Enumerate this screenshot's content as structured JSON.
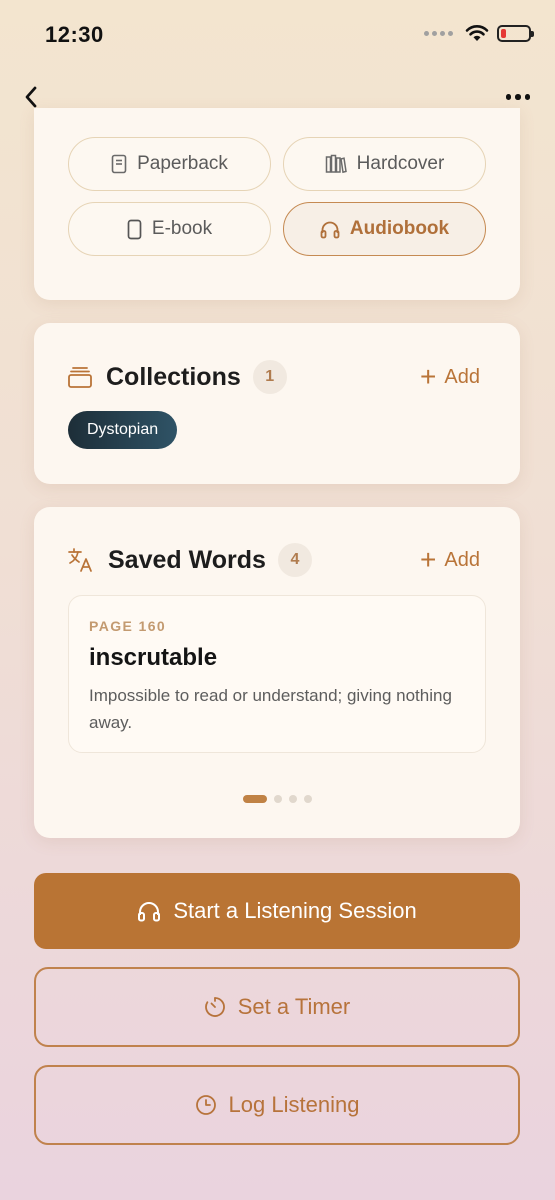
{
  "status_bar": {
    "time": "12:30"
  },
  "formats": {
    "items": [
      {
        "label": "Paperback",
        "icon": "book-icon",
        "active": false
      },
      {
        "label": "Hardcover",
        "icon": "books-icon",
        "active": false
      },
      {
        "label": "E-book",
        "icon": "tablet-icon",
        "active": false
      },
      {
        "label": "Audiobook",
        "icon": "headphones-icon",
        "active": true
      }
    ]
  },
  "collections": {
    "title": "Collections",
    "count": "1",
    "add_label": "Add",
    "tags": [
      "Dystopian"
    ]
  },
  "saved_words": {
    "title": "Saved Words",
    "count": "4",
    "add_label": "Add",
    "current": {
      "page": "PAGE 160",
      "term": "inscrutable",
      "definition": "Impossible to read or understand; giving nothing away."
    },
    "pager": {
      "total": 4,
      "active_index": 0
    }
  },
  "actions": {
    "start_label": "Start a Listening Session",
    "timer_label": "Set a Timer",
    "log_label": "Log Listening"
  },
  "colors": {
    "accent": "#b97434",
    "accent_text": "#b7733b",
    "tag_bg": "#1d2e38"
  }
}
